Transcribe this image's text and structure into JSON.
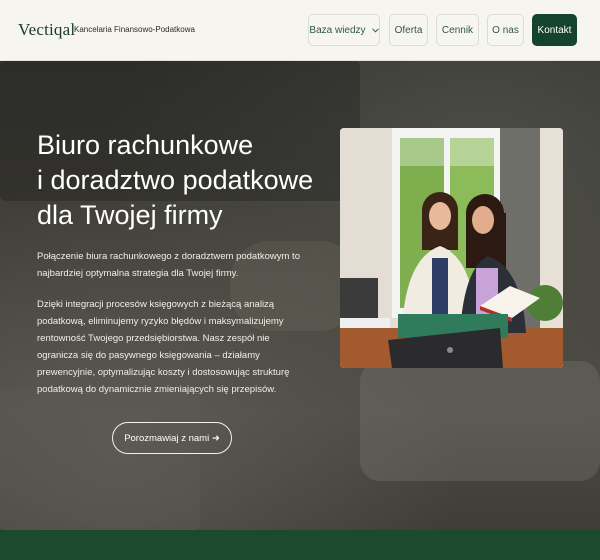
{
  "header": {
    "logo": "Vectiqal",
    "tagline": "Kancelaria Finansowo-Podatkowa",
    "nav": {
      "knowledge": "Baza wiedzy",
      "offer": "Oferta",
      "pricing": "Cennik",
      "about": "O nas",
      "contact": "Kontakt"
    }
  },
  "hero": {
    "title": [
      "Biuro rachunkowe",
      "i doradztwo podatkowe",
      "dla Twojej firmy"
    ],
    "paragraph1": "Połączenie biura rachunkowego z doradztwem podatkowym to najbardziej optymalna strategia dla Twojej firmy.",
    "paragraph2": "Dzięki integracji procesów księgowych z bieżącą analizą podatkową, eliminujemy ryzyko błędów i maksymalizujemy rentowność Twojego przedsiębiorstwa. Nasz zespół nie ogranicza się do pasywnego księgowania – działamy prewencyjnie, optymalizując koszty i dostosowując strukturę podatkową do dynamicznie zmieniających się przepisów.",
    "cta": "Porozmawiaj z nami ➜"
  },
  "colors": {
    "brand_green": "#15442c",
    "header_bg": "#f7f5ef",
    "nav_text": "#2d5b3f"
  },
  "icons": {
    "dropdown": "chevron-down-icon"
  }
}
